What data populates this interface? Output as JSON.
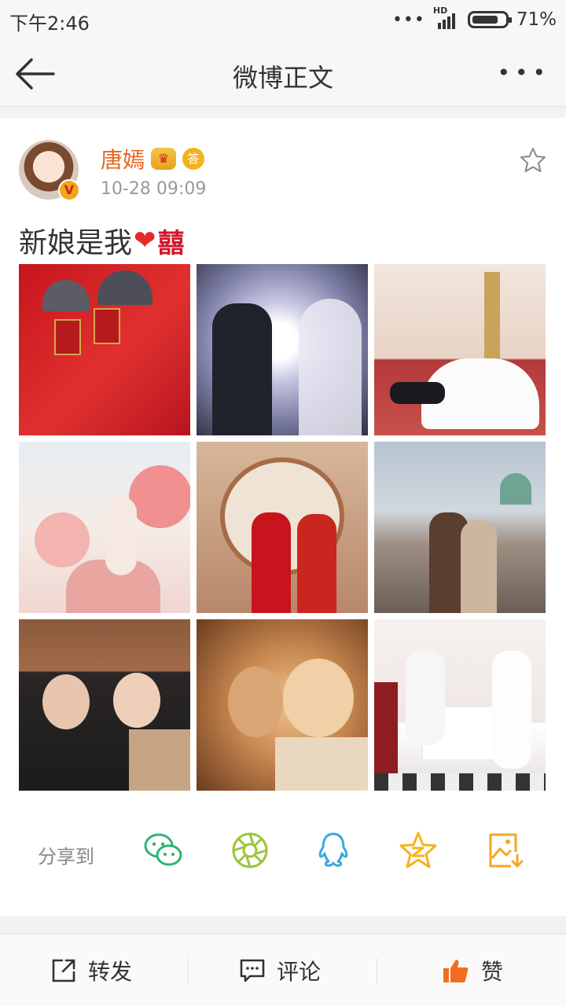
{
  "status_bar": {
    "time": "下午2:46",
    "network": "HD",
    "battery": "71%"
  },
  "nav": {
    "title": "微博正文",
    "more": "•••"
  },
  "post": {
    "username": "唐嫣",
    "badge_crown": "♛",
    "badge_answer": "答",
    "verified": "V",
    "time": "10-28 09:09",
    "text": "新娘是我",
    "emoji_heart": "❤",
    "emoji_xi": "囍"
  },
  "share": {
    "label": "分享到"
  },
  "toolbar": {
    "repost": "转发",
    "comment": "评论",
    "like": "赞"
  },
  "colors": {
    "username": "#e8641c",
    "like": "#f26d21",
    "wechat": "#2bb673",
    "moments": "#9bc53d",
    "qq": "#3aa8e0",
    "qzone": "#f6b21b",
    "save": "#f6a623"
  }
}
